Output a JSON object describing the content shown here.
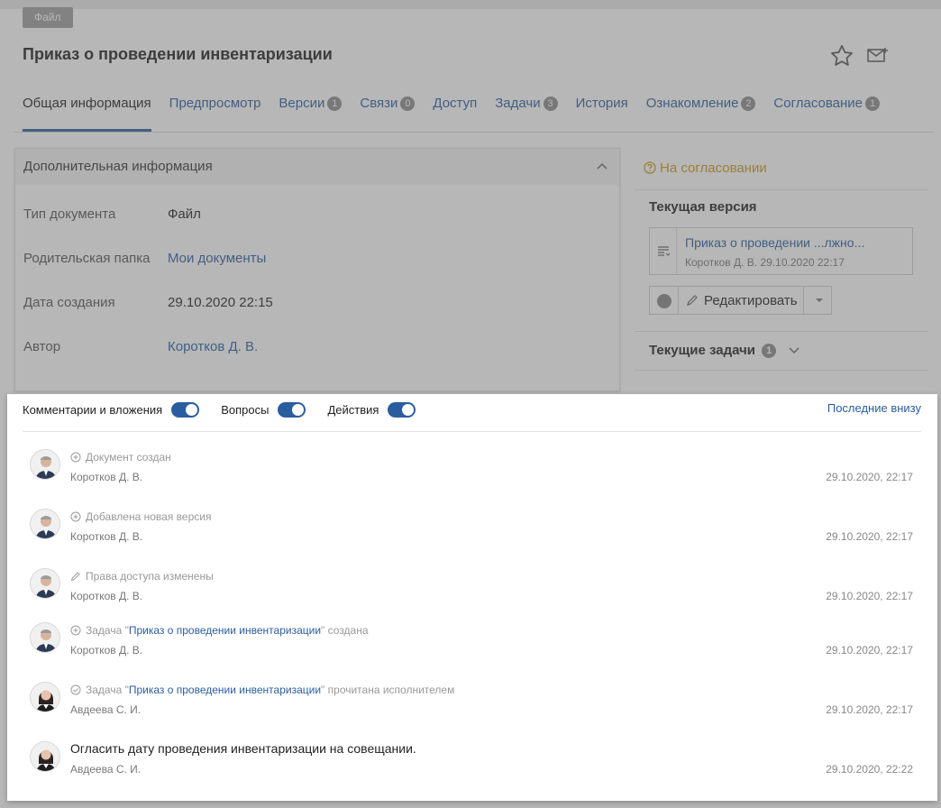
{
  "file_chip": "Файл",
  "doc_title": "Приказ о проведении инвентаризации",
  "icons": {
    "favorite": "star-icon",
    "mail": "mail-plus-icon"
  },
  "tabs": [
    {
      "label": "Общая информация",
      "badge": ""
    },
    {
      "label": "Предпросмотр",
      "badge": ""
    },
    {
      "label": "Версии",
      "badge": "1"
    },
    {
      "label": "Связи",
      "badge": "0"
    },
    {
      "label": "Доступ",
      "badge": ""
    },
    {
      "label": "Задачи",
      "badge": "3"
    },
    {
      "label": "История",
      "badge": ""
    },
    {
      "label": "Ознакомление",
      "badge": "2"
    },
    {
      "label": "Согласование",
      "badge": "1"
    }
  ],
  "info_panel": {
    "title": "Дополнительная информация",
    "rows": [
      {
        "label": "Тип документа",
        "value": "Файл"
      },
      {
        "label": "Родительская папка",
        "value": "Мои документы"
      },
      {
        "label": "Дата создания",
        "value": "29.10.2020 22:15"
      },
      {
        "label": "Автор",
        "value": "Коротков Д. В."
      }
    ]
  },
  "side": {
    "status": "На согласовании",
    "current_version_heading": "Текущая версия",
    "version_title": "Приказ о проведении ...лжно...",
    "version_meta": "Коротков Д. В. 29.10.2020 22:17",
    "edit_label": "Редактировать",
    "tasks_heading": "Текущие задачи",
    "tasks_badge": "1"
  },
  "feed": {
    "filters": [
      {
        "label": "Комментарии и вложения",
        "on": true
      },
      {
        "label": "Вопросы",
        "on": true
      },
      {
        "label": "Действия",
        "on": true
      }
    ],
    "sort_label": "Последние внизу",
    "entries": [
      {
        "prefix": "Документ создан",
        "link": "",
        "suffix": "",
        "author": "Коротков Д. В.",
        "date": "29.10.2020, 22:17",
        "icon": "plus-circle-icon"
      },
      {
        "prefix": "Добавлена новая версия",
        "link": "",
        "suffix": "",
        "author": "Коротков Д. В.",
        "date": "29.10.2020, 22:17",
        "icon": "plus-circle-icon"
      },
      {
        "prefix": "Права доступа изменены",
        "link": "",
        "suffix": "",
        "author": "Коротков Д. В.",
        "date": "29.10.2020, 22:17",
        "icon": "pencil-icon"
      },
      {
        "prefix": "Задача \"",
        "link": "Приказ о проведении инвентаризации",
        "suffix": " \" создана",
        "author": "Коротков Д. В.",
        "date": "29.10.2020, 22:17",
        "icon": "plus-circle-icon"
      },
      {
        "prefix": "Задача \"",
        "link": "Приказ о проведении инвентаризации",
        "suffix": " \" прочитана исполнителем",
        "author": "Авдеева С. И.",
        "date": "29.10.2020, 22:17",
        "icon": "check-circle-icon"
      }
    ],
    "comment": {
      "text": "Огласить дату проведения инвентаризации на совещании.",
      "author": "Авдеева С. И.",
      "date": "29.10.2020, 22:22"
    }
  }
}
